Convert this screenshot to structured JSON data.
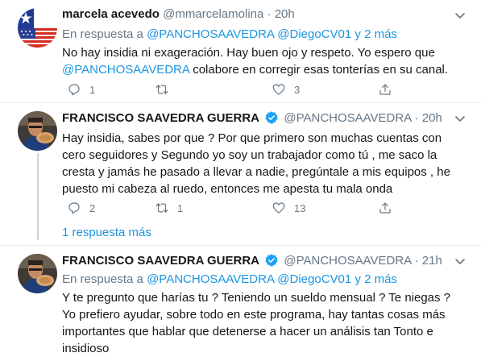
{
  "tweets": [
    {
      "name": "marcela acevedo",
      "handle": "@mmarcelamolina",
      "dot": "·",
      "time": "20h",
      "verified": false,
      "reply_prefix": "En respuesta a",
      "reply_users": "@PANCHOSAAVEDRA @DiegoCV01",
      "reply_suffix": "y 2 más",
      "text_a": "No hay insidia ni exageración. Hay buen ojo y respeto.  Yo espero que",
      "mention": "@PANCHOSAAVEDRA",
      "text_b": "  colabore en corregir esas tonterías en su canal.",
      "replies": "1",
      "retweets": "",
      "likes": "3",
      "avatar_icon": "chile-us-flag-avatar"
    },
    {
      "name": "FRANCISCO SAAVEDRA GUERRA",
      "handle": "@PANCHOSAAVEDRA",
      "dot": "·",
      "time": "20h",
      "verified": true,
      "text": "Hay insidia, sabes por que ? Por que primero son muchas cuentas con cero seguidores y Segundo yo soy un trabajador como tú , me saco la cresta y jamás he pasado a llevar a nadie, pregúntale a mis equipos , he puesto mi cabeza al ruedo, entonces me apesta tu mala onda",
      "replies": "2",
      "retweets": "1",
      "likes": "13",
      "avatar_icon": "profile-photo-avatar"
    },
    {
      "name": "FRANCISCO SAAVEDRA GUERRA",
      "handle": "@PANCHOSAAVEDRA",
      "dot": "·",
      "time": "21h",
      "verified": true,
      "reply_prefix": "En respuesta a",
      "reply_users": "@PANCHOSAAVEDRA @DiegoCV01",
      "reply_suffix": "y 2 más",
      "text": "Y te pregunto que harías tu ? Teniendo un sueldo mensual  ? Te niegas ? Yo prefiero ayudar, sobre todo en este programa, hay tantas cosas más importantes que hablar que detenerse a hacer un análisis tan Tonto e insidioso",
      "avatar_icon": "profile-photo-avatar"
    }
  ],
  "more_replies": "1 respuesta más",
  "colors": {
    "link": "#1b95e0",
    "muted": "#657786",
    "verified": "#1da1f2",
    "border": "#e6ecf0"
  }
}
